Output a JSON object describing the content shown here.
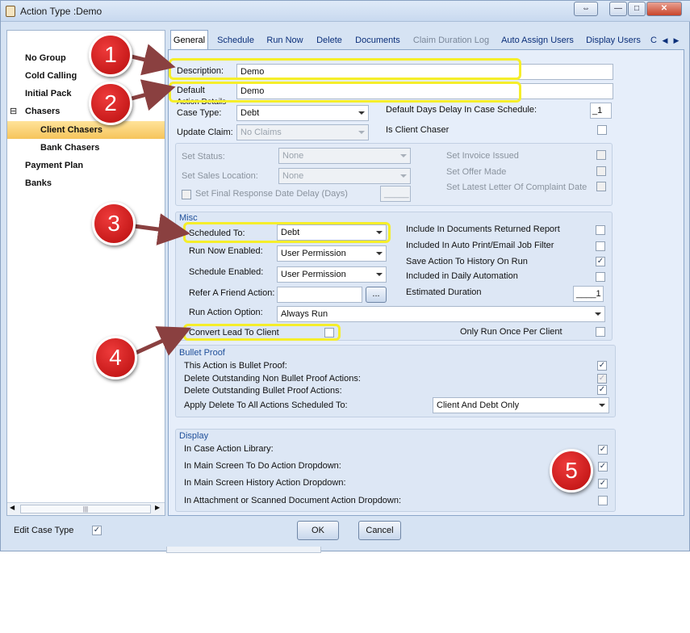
{
  "window": {
    "title": "Action Type :Demo",
    "controls": [
      "⇔",
      "—",
      "□",
      "✕"
    ]
  },
  "tree": {
    "items": [
      {
        "label": "No Group"
      },
      {
        "label": "Cold Calling"
      },
      {
        "label": "Initial Pack"
      },
      {
        "label": "Chasers",
        "expander": "⊟"
      },
      {
        "label": "Client Chasers"
      },
      {
        "label": "Bank Chasers"
      },
      {
        "label": "Payment Plan"
      },
      {
        "label": "Banks"
      }
    ],
    "scroll_grip": "|||"
  },
  "tabs": [
    "General",
    "Schedule",
    "Run Now",
    "Delete",
    "Documents",
    "Claim Duration Log",
    "Auto Assign Users",
    "Display Users",
    "C"
  ],
  "tab_scroll": {
    "left": "◀",
    "right": "▶"
  },
  "general": {
    "description_label": "Description:",
    "description_value": "Demo",
    "default_label": "Default",
    "default_value": "Demo",
    "action_details_label": "Action Details",
    "case_type_label": "Case Type:",
    "case_type_value": "Debt",
    "update_claim_label": "Update Claim:",
    "update_claim_value": "No Claims",
    "default_days_label": "Default Days Delay In Case Schedule:",
    "default_days_value": "_1",
    "is_client_chaser_label": "Is Client Chaser",
    "set_status_label": "Set Status:",
    "set_status_value": "None",
    "set_sales_location_label": "Set Sales Location:",
    "set_sales_location_value": "None",
    "set_final_response_label": "Set Final Response Date Delay (Days)",
    "set_final_response_value": "_____",
    "set_invoice_issued_label": "Set Invoice Issued",
    "set_offer_made_label": "Set Offer Made",
    "set_latest_letter_label": "Set Latest Letter Of Complaint Date"
  },
  "misc": {
    "title": "Misc",
    "scheduled_to_label": "Scheduled To:",
    "scheduled_to_value": "Debt",
    "run_now_enabled_label": "Run Now Enabled:",
    "run_now_enabled_value": "User Permission",
    "schedule_enabled_label": "Schedule Enabled:",
    "schedule_enabled_value": "User Permission",
    "refer_friend_label": "Refer A Friend Action:",
    "refer_friend_button": "...",
    "run_action_option_label": "Run Action Option:",
    "run_action_option_value": "Always Run",
    "convert_lead_label": "Convert Lead To Client",
    "include_docs_returned_label": "Include In Documents Returned Report",
    "included_auto_print_label": "Included In Auto Print/Email Job Filter",
    "save_history_label": "Save Action To History On Run",
    "included_daily_label": "Included in Daily Automation",
    "estimated_duration_label": "Estimated Duration",
    "estimated_duration_value": "____1",
    "only_run_once_label": "Only Run Once Per Client"
  },
  "bullet_proof": {
    "title": "Bullet Proof",
    "is_bullet_proof_label": "This Action is Bullet Proof:",
    "delete_non_bp_label": "Delete Outstanding Non Bullet Proof Actions:",
    "delete_bp_label": "Delete Outstanding Bullet Proof Actions:",
    "apply_delete_label": "Apply Delete To All Actions Scheduled To:",
    "apply_delete_value": "Client And Debt Only"
  },
  "display": {
    "title": "Display",
    "case_action_library_label": "In Case Action Library:",
    "todo_dropdown_label": "In Main Screen To Do Action Dropdown:",
    "history_dropdown_label": "In Main Screen History Action Dropdown:",
    "attachment_dropdown_label": "In Attachment or Scanned Document Action Dropdown:"
  },
  "checkmark": "✓",
  "footer": {
    "edit_case_type_label": "Edit Case Type",
    "ok_label": "OK",
    "cancel_label": "Cancel"
  },
  "callouts": [
    "1",
    "2",
    "3",
    "4",
    "5"
  ],
  "colors": {
    "highlight": "#f5ee2a",
    "marker": "#d01515",
    "arrow": "#8a4040",
    "selected": "#f6c45b"
  }
}
